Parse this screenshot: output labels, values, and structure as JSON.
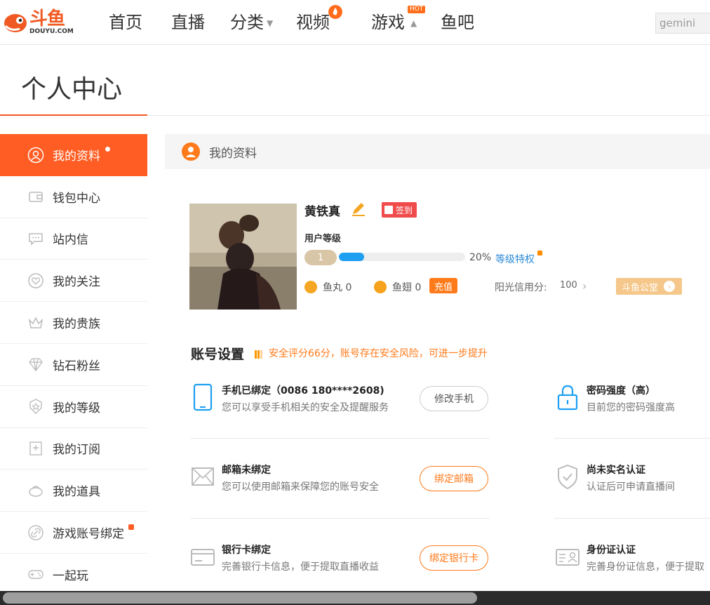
{
  "header": {
    "logo_text": "斗鱼",
    "logo_sub": "DOUYU.COM",
    "nav": [
      {
        "label": "首页"
      },
      {
        "label": "直播"
      },
      {
        "label": "分类"
      },
      {
        "label": "视频"
      },
      {
        "label": "游戏",
        "badge": "HOT"
      },
      {
        "label": "鱼吧"
      }
    ],
    "search_value": "gemini"
  },
  "page_title": "个人中心",
  "sidebar": {
    "items": [
      {
        "label": "我的资料",
        "icon": "user-icon"
      },
      {
        "label": "钱包中心",
        "icon": "wallet-icon"
      },
      {
        "label": "站内信",
        "icon": "message-icon"
      },
      {
        "label": "我的关注",
        "icon": "heart-icon"
      },
      {
        "label": "我的贵族",
        "icon": "crown-icon"
      },
      {
        "label": "钻石粉丝",
        "icon": "diamond-icon"
      },
      {
        "label": "我的等级",
        "icon": "star-badge-icon"
      },
      {
        "label": "我的订阅",
        "icon": "subscribe-icon"
      },
      {
        "label": "我的道具",
        "icon": "gift-icon"
      },
      {
        "label": "游戏账号绑定",
        "icon": "link-icon"
      },
      {
        "label": "一起玩",
        "icon": "gamepad-icon"
      }
    ]
  },
  "main": {
    "section_title": "我的资料",
    "profile": {
      "name": "黄铁真",
      "signin_label": "签到",
      "level_label": "用户等级",
      "level_value": "1",
      "progress_percent": 20,
      "progress_text": "20%",
      "level_link": "等级特权",
      "fish_balls": "鱼丸 0",
      "fish_fins": "鱼翅 0",
      "recharge_label": "充值",
      "credit_label": "阳光信用分:",
      "credit_value": "100",
      "notice_label": "斗鱼公堂"
    },
    "account": {
      "title": "账号设置",
      "warning": "安全评分66分，账号存在安全风险，可进一步提升",
      "rows": [
        {
          "title": "手机已绑定（0086 180****2608)",
          "desc": "您可以享受手机相关的安全及提醒服务",
          "button": "修改手机",
          "icon": "phone-icon"
        },
        {
          "title": "密码强度（高）",
          "desc": "目前您的密码强度高",
          "icon": "lock-icon"
        },
        {
          "title": "邮箱未绑定",
          "desc": "您可以使用邮箱来保障您的账号安全",
          "button": "绑定邮箱",
          "icon": "mail-icon"
        },
        {
          "title": "尚未实名认证",
          "desc": "认证后可申请直播间",
          "icon": "shield-icon"
        },
        {
          "title": "银行卡绑定",
          "desc": "完善银行卡信息，便于提取直播收益",
          "button": "绑定银行卡",
          "icon": "bank-card-icon"
        },
        {
          "title": "身份证认证",
          "desc": "完善身份证信息，便于提取",
          "icon": "id-card-icon"
        }
      ]
    }
  },
  "colors": {
    "brand": "#f05a22",
    "active_item": "#ff5d23",
    "link_blue": "#2b8ad8",
    "warning_orange": "#ff7a1a"
  }
}
